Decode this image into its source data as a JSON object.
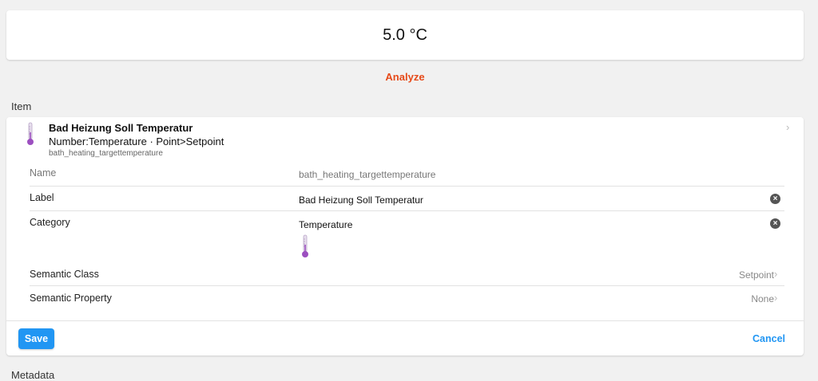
{
  "state": {
    "value": "5.0 °C"
  },
  "analyze_label": "Analyze",
  "item_section_title": "Item",
  "item": {
    "title": "Bad Heizung Soll Temperatur",
    "subtitle": "Number:Temperature · Point>Setpoint",
    "footer": "bath_heating_targettemperature",
    "icon": "thermometer-icon"
  },
  "fields": {
    "name": {
      "label": "Name",
      "value": "bath_heating_targettemperature"
    },
    "label": {
      "label": "Label",
      "value": "Bad Heizung Soll Temperatur"
    },
    "category": {
      "label": "Category",
      "value": "Temperature",
      "icon": "thermometer-icon"
    },
    "semantic_class": {
      "label": "Semantic Class",
      "value": "Setpoint"
    },
    "semantic_property": {
      "label": "Semantic Property",
      "value": "None"
    }
  },
  "actions": {
    "save": "Save",
    "cancel": "Cancel"
  },
  "metadata_section_title": "Metadata",
  "colors": {
    "accent": "#2196f3",
    "analyze": "#e64a19",
    "thermometer": "#9c4fc0"
  }
}
